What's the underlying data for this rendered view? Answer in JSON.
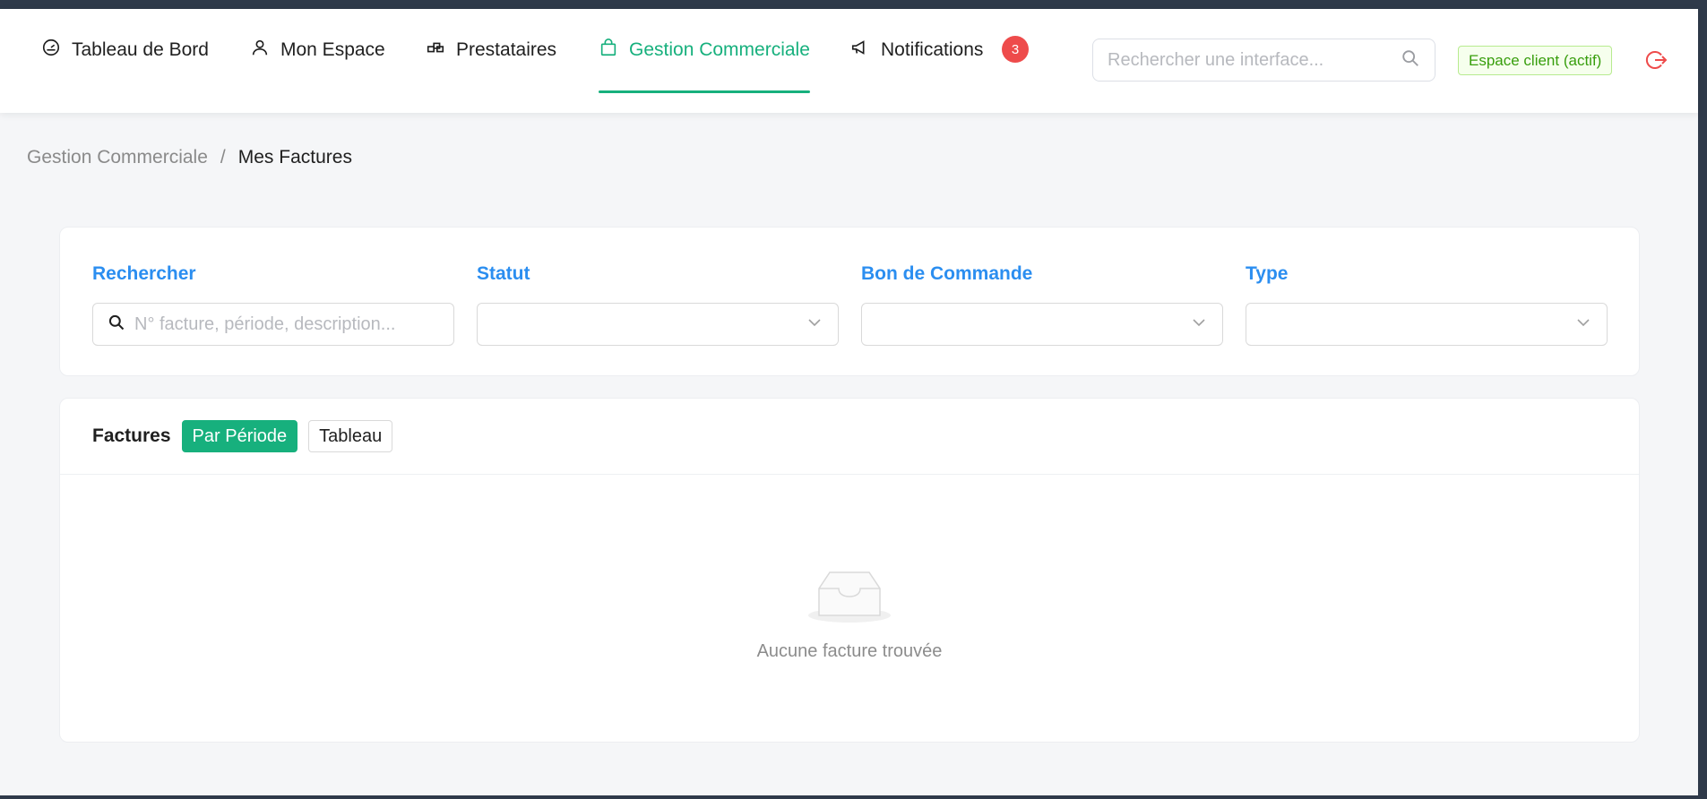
{
  "nav": {
    "items": [
      {
        "label": "Tableau de Bord",
        "icon": "dashboard-icon"
      },
      {
        "label": "Mon Espace",
        "icon": "user-icon"
      },
      {
        "label": "Prestataires",
        "icon": "providers-icon"
      },
      {
        "label": "Gestion Commerciale",
        "icon": "shopping-bag-icon",
        "active": true
      },
      {
        "label": "Notifications",
        "icon": "megaphone-icon"
      }
    ],
    "notification_count": "3",
    "search_placeholder": "Rechercher une interface...",
    "client_tag": "Espace client (actif)"
  },
  "breadcrumb": {
    "parent": "Gestion Commerciale",
    "separator": "/",
    "current": "Mes Factures"
  },
  "filters": {
    "search_label": "Rechercher",
    "search_placeholder": "N° facture, période, description...",
    "status_label": "Statut",
    "status_value": "",
    "purchase_order_label": "Bon de Commande",
    "purchase_order_value": "",
    "type_label": "Type",
    "type_value": ""
  },
  "invoices": {
    "title": "Factures",
    "view_period": "Par Période",
    "view_table": "Tableau",
    "empty_text": "Aucune facture trouvée"
  },
  "colors": {
    "accent": "#17b07d",
    "label_blue": "#2b8ef0",
    "badge_red": "#ee4b4b",
    "tag_green": "#389e0d"
  }
}
